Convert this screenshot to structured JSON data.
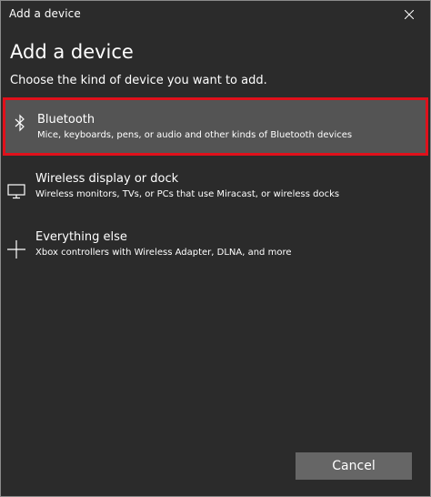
{
  "window": {
    "title": "Add a device",
    "close_icon": "close-icon"
  },
  "main": {
    "heading": "Add a device",
    "subheading": "Choose the kind of device you want to add."
  },
  "options": [
    {
      "icon": "bluetooth-icon",
      "label": "Bluetooth",
      "description": "Mice, keyboards, pens, or audio and other kinds of Bluetooth devices",
      "selected": true
    },
    {
      "icon": "monitor-icon",
      "label": "Wireless display or dock",
      "description": "Wireless monitors, TVs, or PCs that use Miracast, or wireless docks",
      "selected": false
    },
    {
      "icon": "plus-icon",
      "label": "Everything else",
      "description": "Xbox controllers with Wireless Adapter, DLNA, and more",
      "selected": false
    }
  ],
  "footer": {
    "cancel_label": "Cancel"
  },
  "colors": {
    "background": "#2b2b2b",
    "selected_background": "#545454",
    "highlight_border": "#e0101b",
    "button_background": "#666666",
    "text": "#ffffff"
  }
}
